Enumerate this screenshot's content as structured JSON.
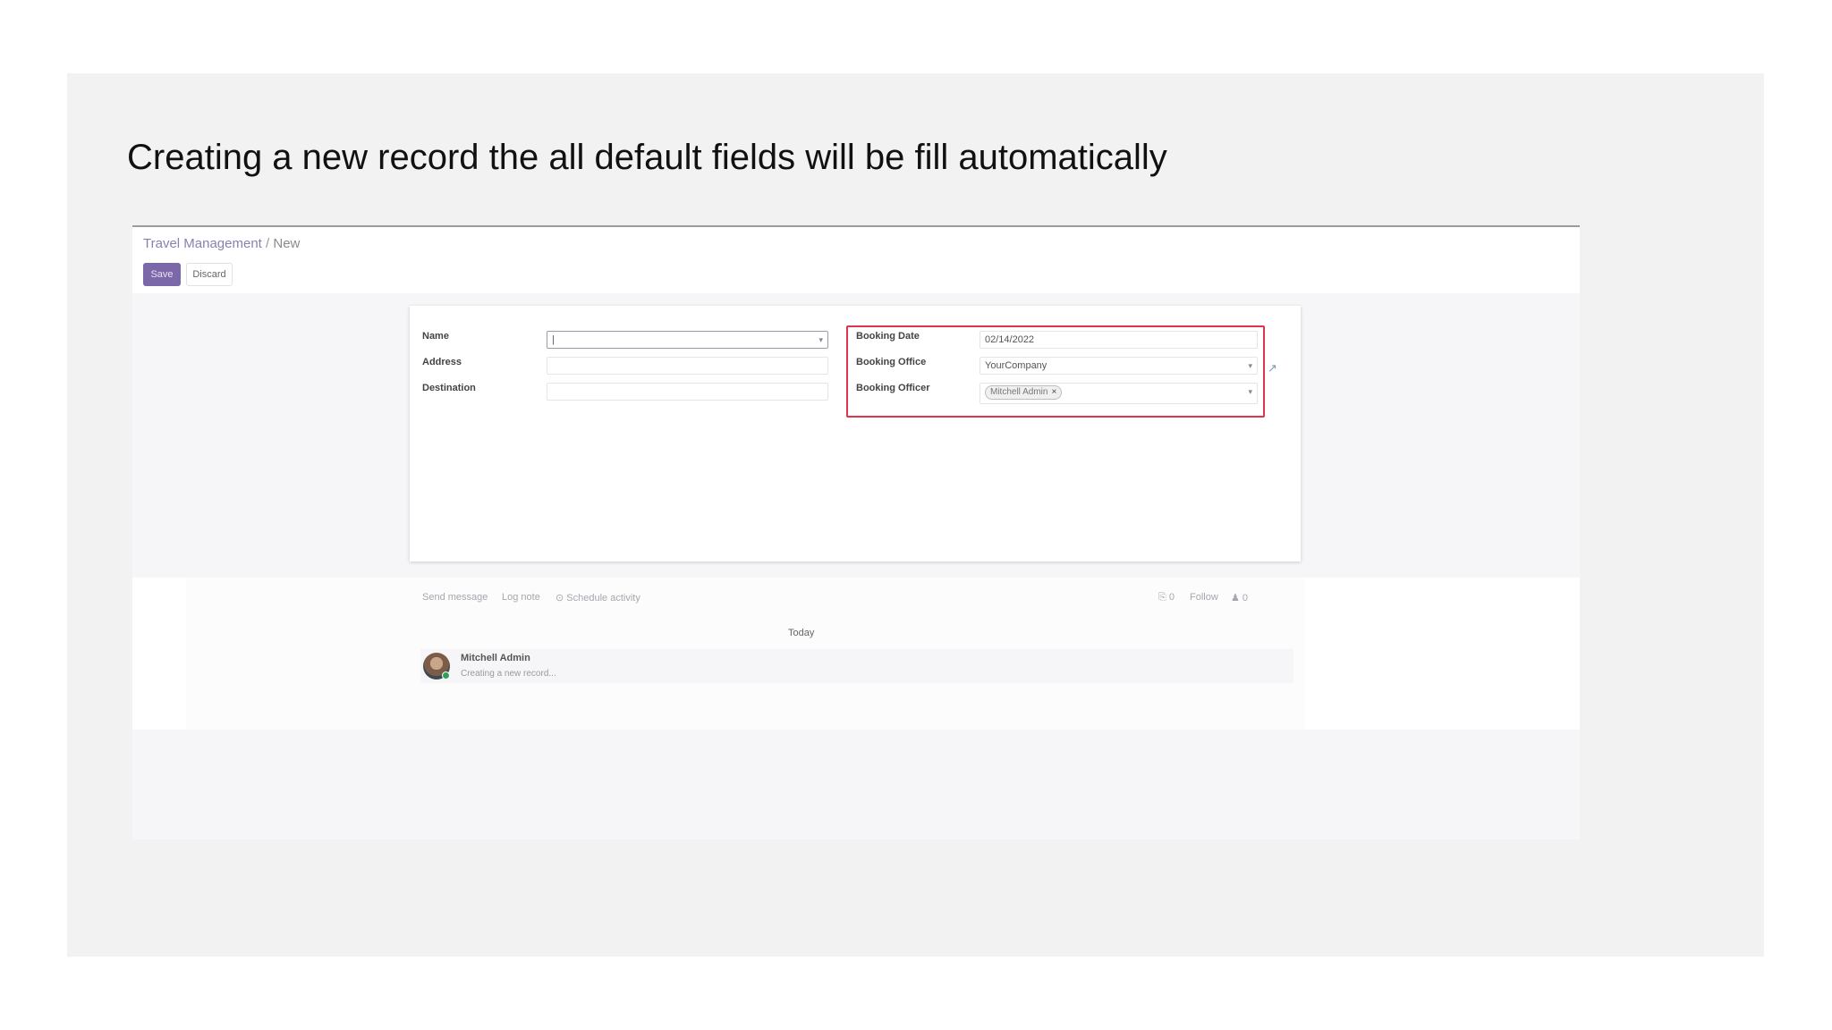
{
  "slide": {
    "title": "Creating a new record the all default fields will be fill automatically"
  },
  "controlpanel": {
    "breadcrumb": {
      "parent": "Travel Management",
      "separator": "/",
      "current": "New"
    },
    "save_label": "Save",
    "discard_label": "Discard"
  },
  "form": {
    "name_label": "Name",
    "name_value": "|",
    "address_label": "Address",
    "address_value": "",
    "destination_label": "Destination",
    "destination_value": "",
    "booking_date_label": "Booking Date",
    "booking_date_value": "02/14/2022",
    "booking_office_label": "Booking Office",
    "booking_office_value": "YourCompany",
    "booking_officer_label": "Booking Officer",
    "booking_officer_tag": "Mitchell Admin",
    "tag_remove": "×",
    "dropdown_caret": "▾",
    "external_link_icon": "external-link-icon",
    "highlight_color": "#e0344c"
  },
  "chatter": {
    "send_message": "Send message",
    "log_note": "Log note",
    "schedule_activity": "⊙ Schedule activity",
    "attachments": "⎘ 0",
    "follow": "Follow",
    "followers": "♟ 0",
    "date_separator": "Today",
    "message": {
      "author": "Mitchell Admin",
      "body": "Creating a new record..."
    }
  },
  "colors": {
    "brand": "#7a68a8",
    "slide_bg": "#f2f2f3"
  }
}
